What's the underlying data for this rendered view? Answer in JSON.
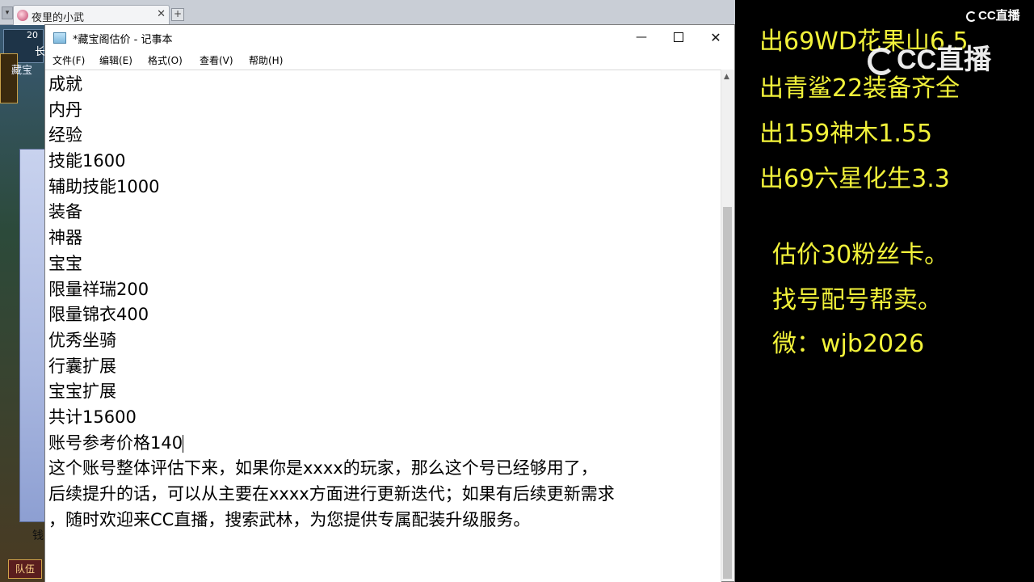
{
  "browser": {
    "tab_title": "夜里的小武",
    "tab_close": "✕",
    "new_tab": "+",
    "nav": "▾"
  },
  "game": {
    "fragment_1": "藏宝",
    "fragment_2": "钱",
    "fragment_3": "队伍",
    "fragment_4": "20",
    "fragment_5": "长"
  },
  "notepad": {
    "title": "*藏宝阁估价 - 记事本",
    "menu": [
      {
        "label": "文件(F)"
      },
      {
        "label": "编辑(E)"
      },
      {
        "label": "格式(O)"
      },
      {
        "label": "查看(V)"
      },
      {
        "label": "帮助(H)"
      }
    ],
    "lines": [
      "成就",
      "内丹",
      "经验",
      "技能1600",
      "辅助技能1000",
      "装备",
      "神器",
      "宝宝",
      "限量祥瑞200",
      "限量锦衣400",
      "优秀坐骑",
      "行囊扩展",
      "宝宝扩展",
      "共计15600",
      "账号参考价格140",
      "这个账号整体评估下来，如果你是xxxx的玩家，那么这个号已经够用了，",
      "后续提升的话，可以从主要在xxxx方面进行更新迭代；如果有后续更新需求",
      "，随时欢迎来CC直播，搜索武林，为您提供专属配装升级服务。"
    ]
  },
  "overlay": {
    "top_lines": [
      "出69WD花果山6.5",
      "出青鲨22装备齐全",
      "出159神木1.55",
      "出69六星化生3.3"
    ],
    "bottom_lines": [
      "估价30粉丝卡。",
      "找号配号帮卖。",
      "微：wjb2026"
    ],
    "logo_small": "CC直播",
    "logo_big": "CC直播"
  },
  "colors": {
    "overlay_text": "#f2f23a",
    "overlay_bg": "#000000"
  }
}
